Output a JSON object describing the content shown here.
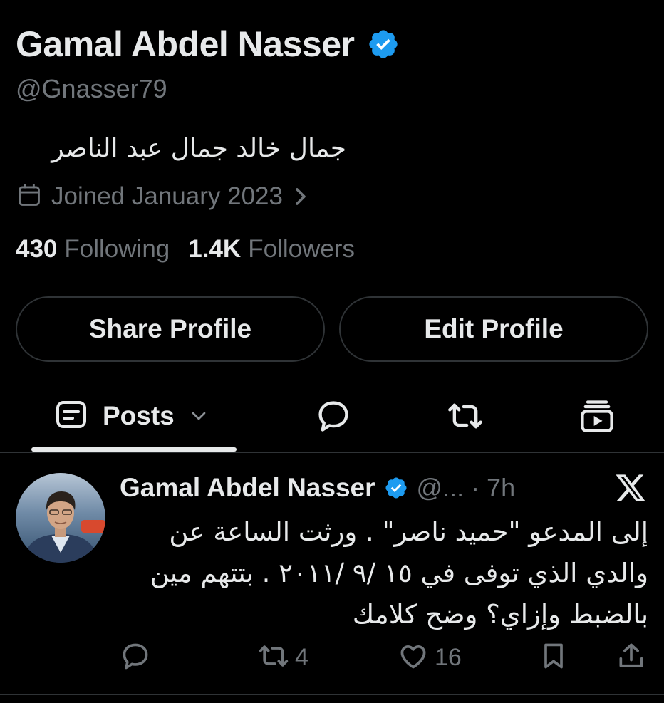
{
  "profile": {
    "display_name": "Gamal Abdel Nasser",
    "handle": "@Gnasser79",
    "bio": "جمال خالد جمال عبد الناصر",
    "joined": "Joined January 2023",
    "following_count": "430",
    "following_label": "Following",
    "followers_count": "1.4K",
    "followers_label": "Followers"
  },
  "buttons": {
    "share_profile": "Share Profile",
    "edit_profile": "Edit Profile"
  },
  "tabs": {
    "posts_label": "Posts",
    "icons": [
      "posts-icon",
      "replies-icon",
      "reposts-icon",
      "media-icon"
    ]
  },
  "tweet": {
    "author_name": "Gamal Abdel Nasser",
    "author_handle_time": "@... · 7h",
    "lines": [
      "إلى المدعو \"حميد ناصر\" . ورثت الساعة عن",
      "والدي الذي توفى في ١٥ /٩ /٢٠١١ . بتتهم مين",
      "بالضبط وإزاي؟ وضح كلامك"
    ],
    "retweets": "4",
    "likes": "16"
  },
  "colors": {
    "background": "#000000",
    "text_primary": "#e7e9ea",
    "text_secondary": "#71767b",
    "verified": "#1d9bf0",
    "border": "#2f3336"
  }
}
